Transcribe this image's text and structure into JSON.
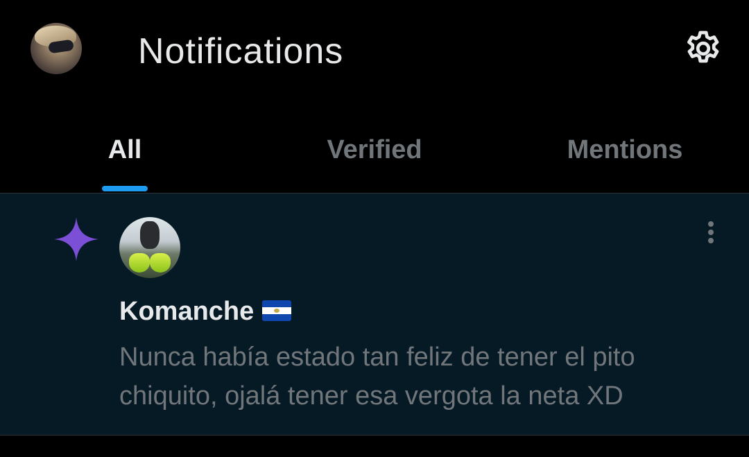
{
  "header": {
    "title": "Notifications",
    "avatar_icon": "profile-avatar",
    "settings_icon": "gear-icon"
  },
  "tabs": [
    {
      "label": "All",
      "active": true
    },
    {
      "label": "Verified",
      "active": false
    },
    {
      "label": "Mentions",
      "active": false
    }
  ],
  "notification": {
    "type_icon": "sparkle-icon",
    "user_name": "Komanche",
    "flag_icon": "el-salvador-flag",
    "text": "Nunca había estado tan feliz de tener el pito chiquito, ojalá tener esa vergota la neta XD",
    "menu_icon": "more-vertical-icon"
  },
  "colors": {
    "background": "#000000",
    "notification_bg": "#061a26",
    "accent": "#1d9bf0",
    "sparkle": "#7b4fd6",
    "text_primary": "#e7e9ea",
    "text_secondary": "#71767b"
  }
}
